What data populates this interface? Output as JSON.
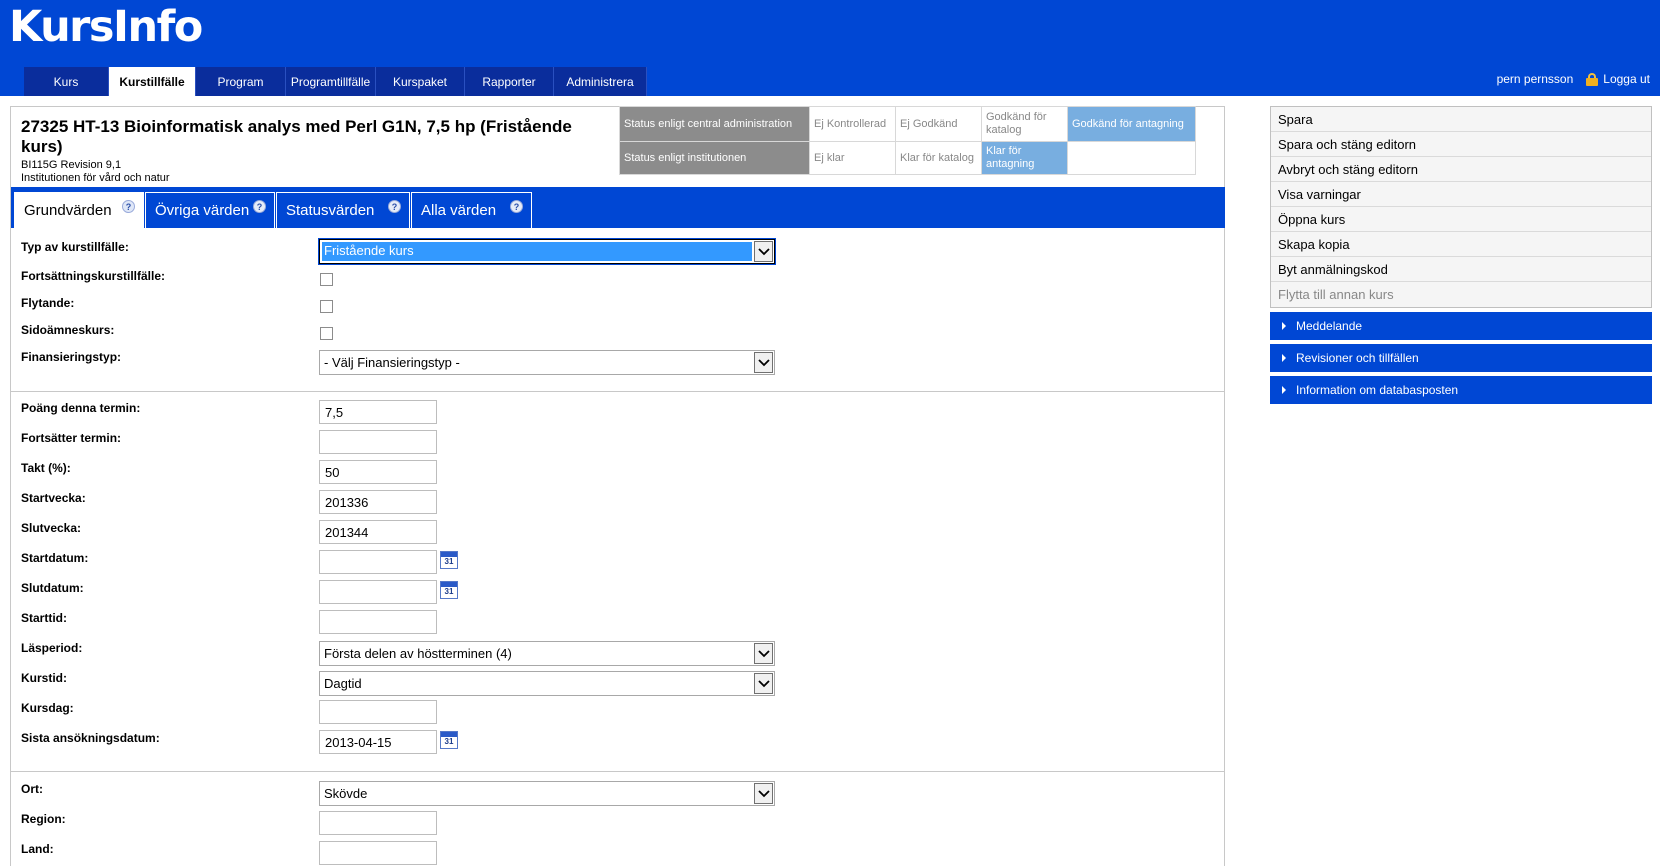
{
  "app": {
    "logo": "KursInfo"
  },
  "nav": [
    {
      "label": "Kurs",
      "active": false
    },
    {
      "label": "Kurstillfälle",
      "active": true
    },
    {
      "label": "Program",
      "active": false
    },
    {
      "label": "Programtillfälle",
      "active": false
    },
    {
      "label": "Kurspaket",
      "active": false
    },
    {
      "label": "Rapporter",
      "active": false
    },
    {
      "label": "Administrera",
      "active": false
    }
  ],
  "user": {
    "name": "pern pernsson",
    "logout": "Logga ut"
  },
  "course": {
    "title": "27325 HT-13 Bioinformatisk analys med Perl G1N, 7,5 hp (Fristående kurs)",
    "code_revision": "BI115G Revision 9,1",
    "department": "Institutionen för vård och natur"
  },
  "status": {
    "central_label": "Status enligt central administration",
    "central": [
      "Ej Kontrollerad",
      "Ej Godkänd",
      "Godkänd för katalog",
      "Godkänd för antagning"
    ],
    "institution_label": "Status enligt institutionen",
    "institution": [
      "Ej klar",
      "Klar för katalog",
      "Klar för antagning"
    ]
  },
  "tabs": [
    {
      "label": "Grundvärden",
      "active": true
    },
    {
      "label": "Övriga värden",
      "active": false
    },
    {
      "label": "Statusvärden",
      "active": false
    },
    {
      "label": "Alla värden",
      "active": false
    }
  ],
  "form": {
    "typ": {
      "label": "Typ av kurstillfälle:",
      "value": "Fristående kurs"
    },
    "fortsattning": {
      "label": "Fortsättningskurstillfälle:",
      "checked": false
    },
    "flytande": {
      "label": "Flytande:",
      "checked": false
    },
    "sidoamne": {
      "label": "Sidoämneskurs:",
      "checked": false
    },
    "finansiering": {
      "label": "Finansieringstyp:",
      "value": "- Välj Finansieringstyp -"
    },
    "poang": {
      "label": "Poäng denna termin:",
      "value": "7,5"
    },
    "fortsatter": {
      "label": "Fortsätter termin:",
      "value": ""
    },
    "takt": {
      "label": "Takt (%):",
      "value": "50"
    },
    "startvecka": {
      "label": "Startvecka:",
      "value": "201336"
    },
    "slutvecka": {
      "label": "Slutvecka:",
      "value": "201344"
    },
    "startdatum": {
      "label": "Startdatum:",
      "value": ""
    },
    "slutdatum": {
      "label": "Slutdatum:",
      "value": ""
    },
    "starttid": {
      "label": "Starttid:",
      "value": ""
    },
    "lasperiod": {
      "label": "Läsperiod:",
      "value": "Första delen av höstterminen (4)"
    },
    "kurstid": {
      "label": "Kurstid:",
      "value": "Dagtid"
    },
    "kursdag": {
      "label": "Kursdag:",
      "value": ""
    },
    "sista": {
      "label": "Sista ansökningsdatum:",
      "value": "2013-04-15"
    },
    "ort": {
      "label": "Ort:",
      "value": "Skövde"
    },
    "region": {
      "label": "Region:",
      "value": ""
    },
    "land": {
      "label": "Land:",
      "value": ""
    },
    "calendar_day": "31"
  },
  "actions": [
    {
      "label": "Spara",
      "enabled": true
    },
    {
      "label": "Spara och stäng editorn",
      "enabled": true
    },
    {
      "label": "Avbryt och stäng editorn",
      "enabled": true
    },
    {
      "label": "Visa varningar",
      "enabled": true
    },
    {
      "label": "Öppna kurs",
      "enabled": true
    },
    {
      "label": "Skapa kopia",
      "enabled": true
    },
    {
      "label": "Byt anmälningskod",
      "enabled": true
    },
    {
      "label": "Flytta till annan kurs",
      "enabled": false
    }
  ],
  "panels": [
    "Meddelande",
    "Revisioner och tillfällen",
    "Information om databasposten"
  ]
}
